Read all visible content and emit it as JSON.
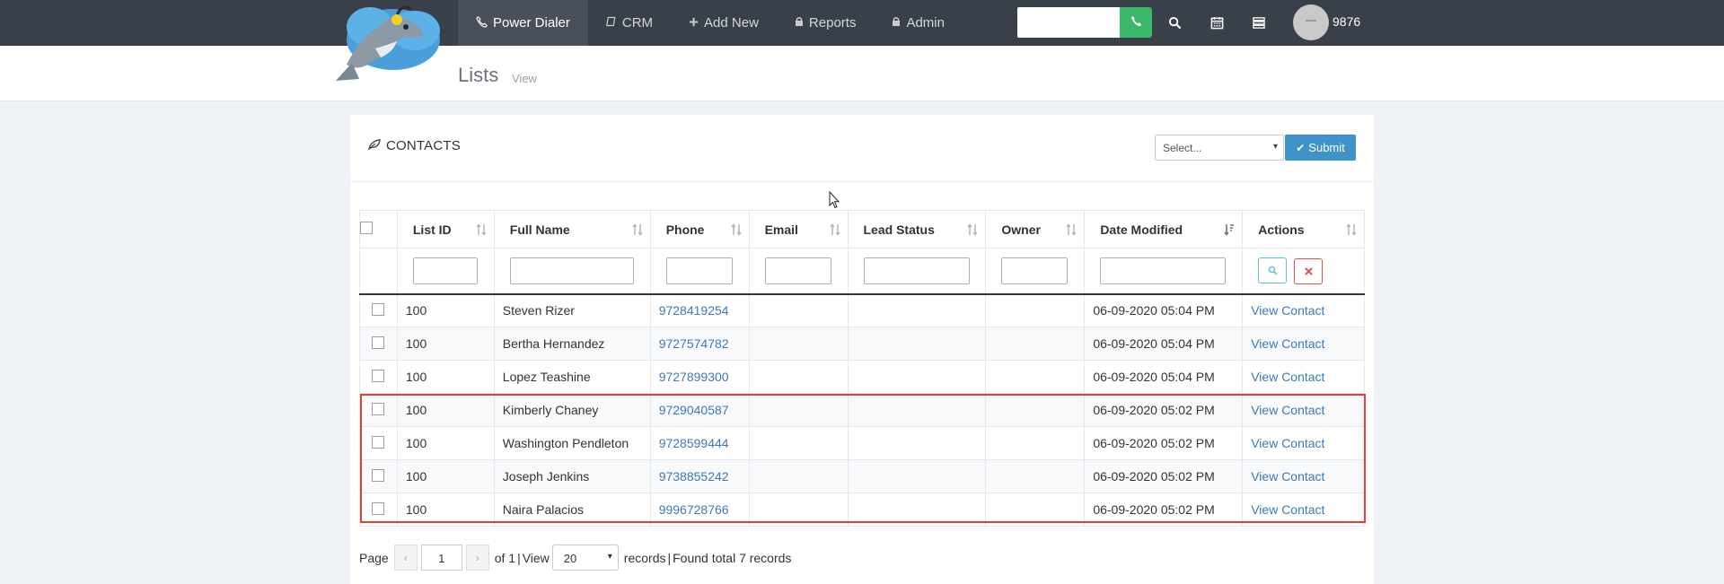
{
  "nav": {
    "items": [
      {
        "label": "Power Dialer",
        "icon": "phone-icon"
      },
      {
        "label": "CRM",
        "icon": "book-icon"
      },
      {
        "label": "Add New",
        "icon": "plus-icon"
      },
      {
        "label": "Reports",
        "icon": "lock-icon"
      },
      {
        "label": "Admin",
        "icon": "lock-icon"
      }
    ],
    "user_ext": "9876"
  },
  "page": {
    "title": "Lists",
    "subtitle": "View"
  },
  "card": {
    "title": "CONTACTS",
    "select_value": "Select...",
    "submit_label": "Submit"
  },
  "table": {
    "headers": [
      "List ID",
      "Full Name",
      "Phone",
      "Email",
      "Lead Status",
      "Owner",
      "Date Modified",
      "Actions"
    ],
    "rows": [
      {
        "list_id": "100",
        "name": "Steven Rizer",
        "phone": "9728419254",
        "email": "",
        "status": "",
        "owner": "",
        "date": "06-09-2020 05:04 PM",
        "action": "View Contact"
      },
      {
        "list_id": "100",
        "name": "Bertha Hernandez",
        "phone": "9727574782",
        "email": "",
        "status": "",
        "owner": "",
        "date": "06-09-2020 05:04 PM",
        "action": "View Contact"
      },
      {
        "list_id": "100",
        "name": "Lopez Teashine",
        "phone": "9727899300",
        "email": "",
        "status": "",
        "owner": "",
        "date": "06-09-2020 05:04 PM",
        "action": "View Contact"
      },
      {
        "list_id": "100",
        "name": "Kimberly Chaney",
        "phone": "9729040587",
        "email": "",
        "status": "",
        "owner": "",
        "date": "06-09-2020 05:02 PM",
        "action": "View Contact"
      },
      {
        "list_id": "100",
        "name": "Washington Pendleton",
        "phone": "9728599444",
        "email": "",
        "status": "",
        "owner": "",
        "date": "06-09-2020 05:02 PM",
        "action": "View Contact"
      },
      {
        "list_id": "100",
        "name": "Joseph Jenkins",
        "phone": "9738855242",
        "email": "",
        "status": "",
        "owner": "",
        "date": "06-09-2020 05:02 PM",
        "action": "View Contact"
      },
      {
        "list_id": "100",
        "name": "Naira Palacios",
        "phone": "9996728766",
        "email": "",
        "status": "",
        "owner": "",
        "date": "06-09-2020 05:02 PM",
        "action": "View Contact"
      }
    ]
  },
  "pager": {
    "page_label": "Page",
    "prev": "‹",
    "next": "›",
    "current_page": "1",
    "of_text": "of 1",
    "sep": "|",
    "view_label": "View",
    "per_page": "20",
    "records_label": "records",
    "found_text": "Found total 7 records"
  },
  "colors": {
    "topbar": "#3a4049",
    "accent": "#3f93c6",
    "call": "#3cb86a",
    "highlight": "#e0403c",
    "link": "#3a7ab8"
  }
}
